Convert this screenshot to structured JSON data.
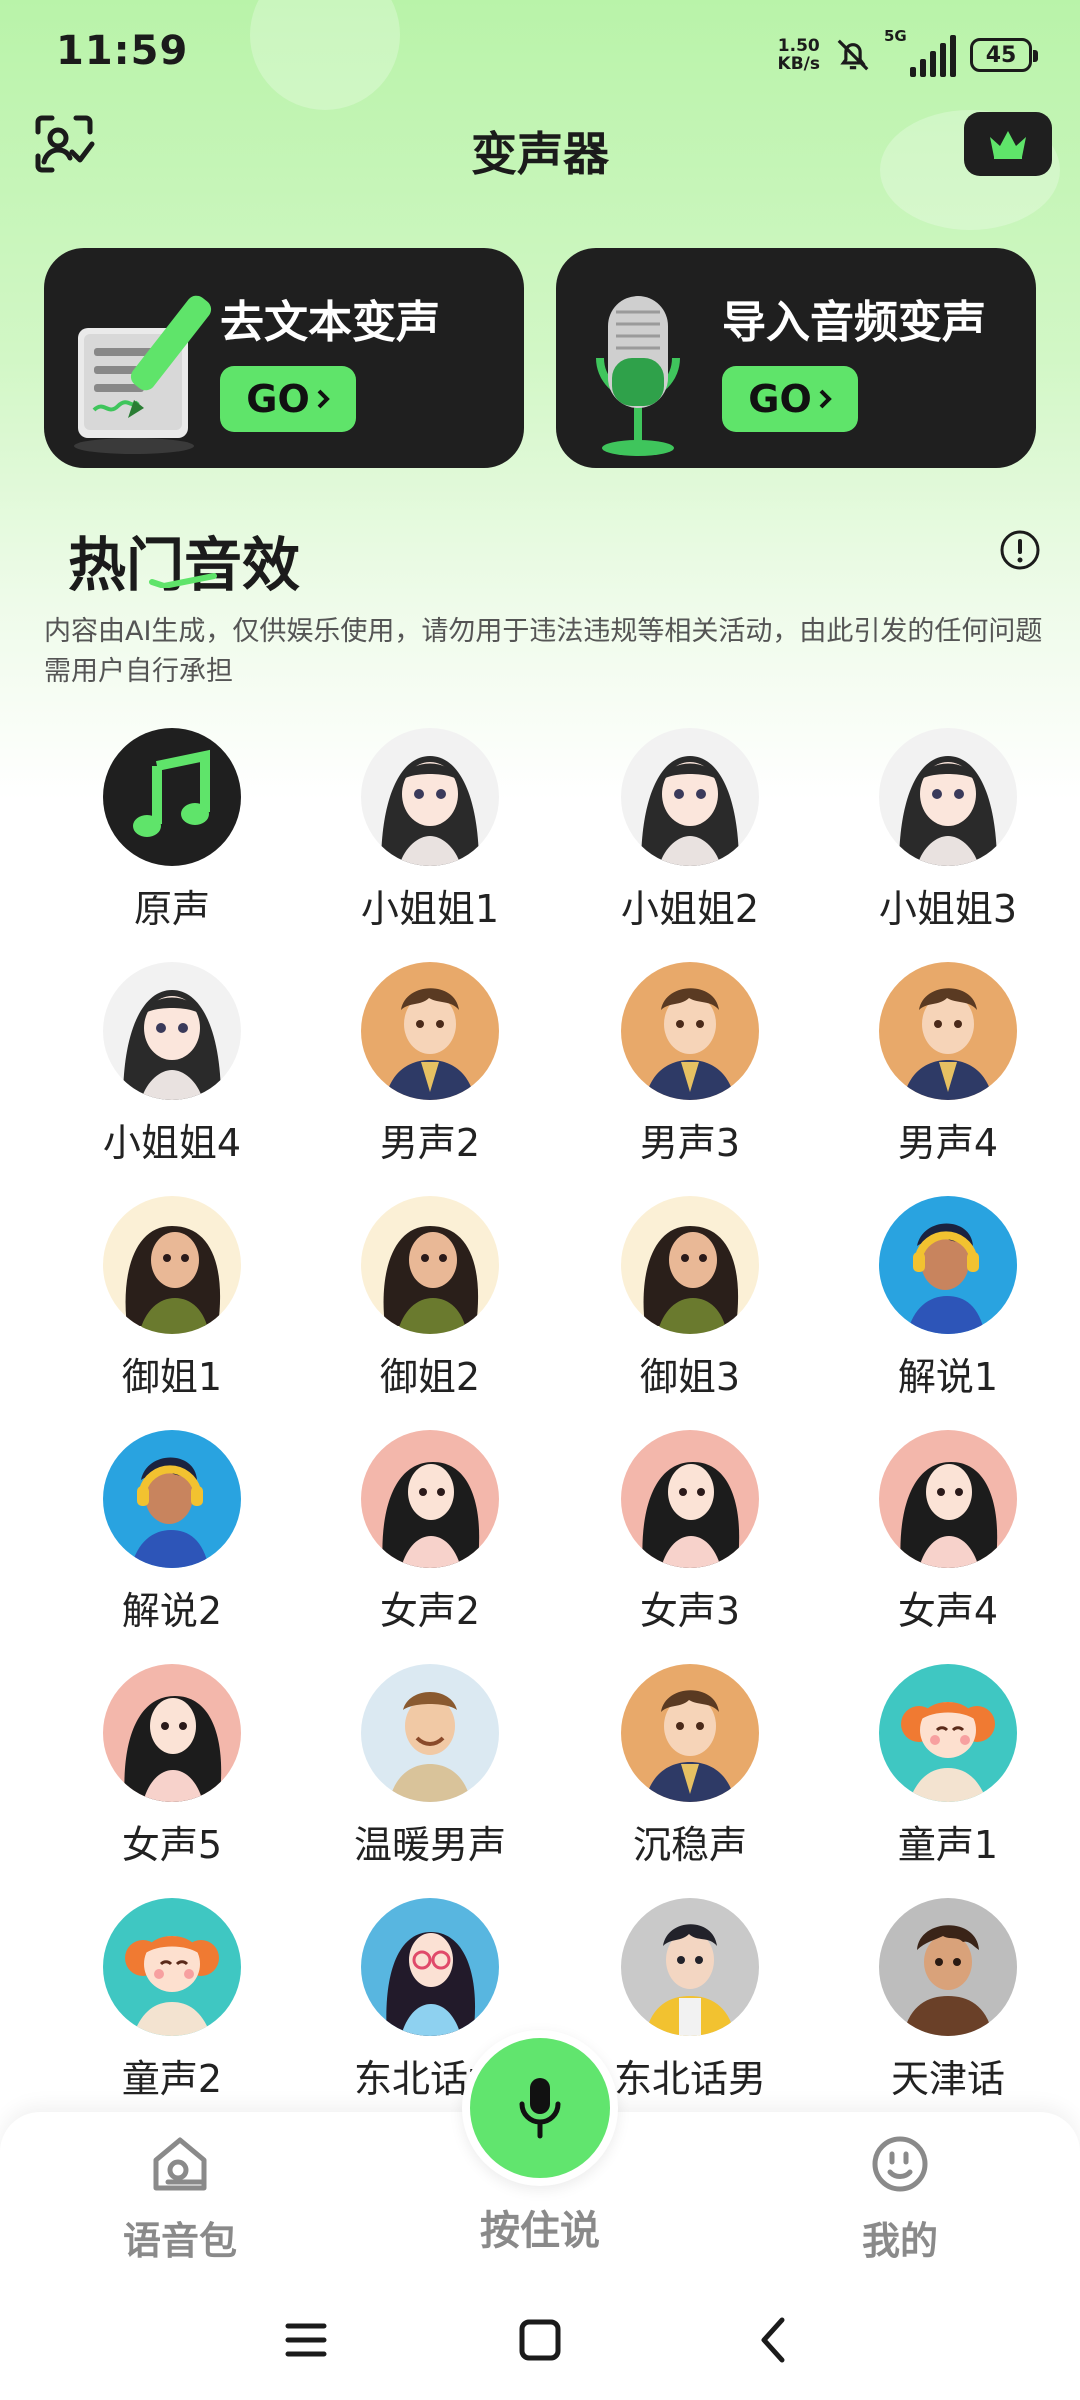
{
  "status": {
    "time": "11:59",
    "net_speed_value": "1.50",
    "net_speed_unit": "KB/s",
    "signal_label": "5G",
    "battery": "45"
  },
  "header": {
    "title": "变声器",
    "scan_icon": "scan-face-icon",
    "vip_icon": "crown-icon"
  },
  "cards": [
    {
      "title": "去文本变声",
      "button": "GO",
      "icon": "document-pen-icon"
    },
    {
      "title": "导入音频变声",
      "button": "GO",
      "icon": "microphone-icon"
    }
  ],
  "section": {
    "title": "热门音效",
    "disclaimer": "内容由AI生成，仅供娱乐使用，请勿用于违法违规等相关活动，由此引发的任何问题需用户自行承担"
  },
  "voices": [
    {
      "label": "原声",
      "avatar": "music-note"
    },
    {
      "label": "小姐姐1",
      "avatar": "girl-dark-hair"
    },
    {
      "label": "小姐姐2",
      "avatar": "girl-dark-hair"
    },
    {
      "label": "小姐姐3",
      "avatar": "girl-dark-hair"
    },
    {
      "label": "小姐姐4",
      "avatar": "girl-dark-hair"
    },
    {
      "label": "男声2",
      "avatar": "man-suit"
    },
    {
      "label": "男声3",
      "avatar": "man-suit"
    },
    {
      "label": "男声4",
      "avatar": "man-suit"
    },
    {
      "label": "御姐1",
      "avatar": "woman-wavy-hair"
    },
    {
      "label": "御姐2",
      "avatar": "woman-wavy-hair"
    },
    {
      "label": "御姐3",
      "avatar": "woman-wavy-hair"
    },
    {
      "label": "解说1",
      "avatar": "man-headphones"
    },
    {
      "label": "解说2",
      "avatar": "man-headphones"
    },
    {
      "label": "女声2",
      "avatar": "woman-pink"
    },
    {
      "label": "女声3",
      "avatar": "woman-pink"
    },
    {
      "label": "女声4",
      "avatar": "woman-pink"
    },
    {
      "label": "女声5",
      "avatar": "woman-pink"
    },
    {
      "label": "温暖男声",
      "avatar": "man-smiling"
    },
    {
      "label": "沉稳声",
      "avatar": "man-suit"
    },
    {
      "label": "童声1",
      "avatar": "child-girl"
    },
    {
      "label": "童声2",
      "avatar": "child-girl"
    },
    {
      "label": "东北话女",
      "avatar": "woman-glasses"
    },
    {
      "label": "东北话男",
      "avatar": "man-yellow-jacket"
    },
    {
      "label": "天津话",
      "avatar": "man-curly"
    }
  ],
  "bottom_nav": {
    "voice_pack": "语音包",
    "hold_to_talk": "按住说",
    "mine": "我的"
  },
  "colors": {
    "accent_green": "#5fe46a",
    "card_dark": "#1f1f1f"
  }
}
